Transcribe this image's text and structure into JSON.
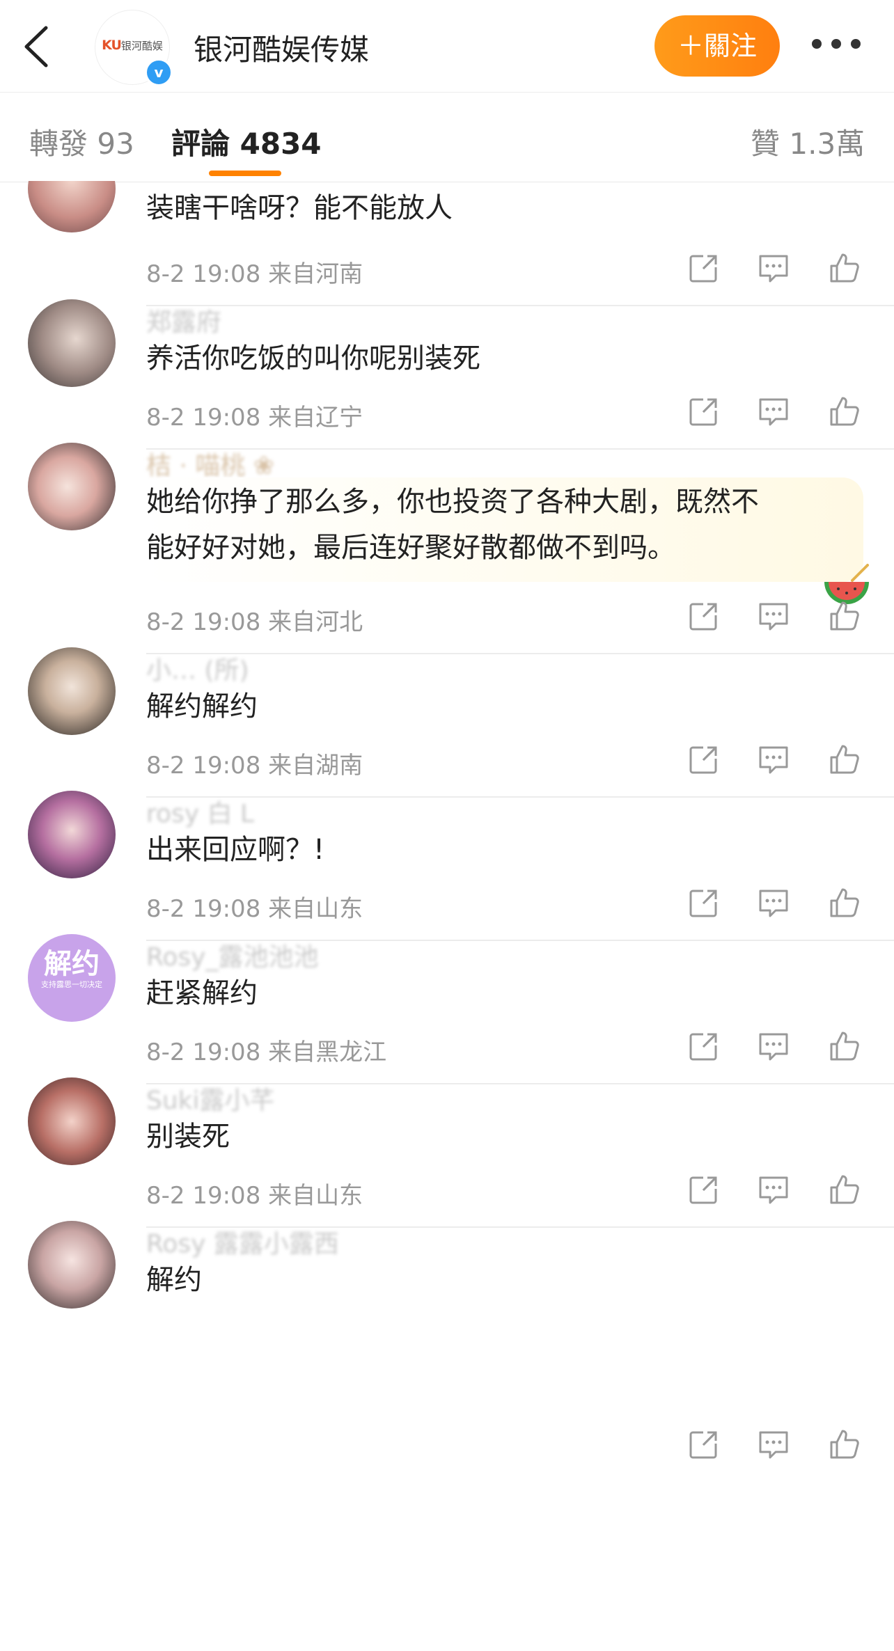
{
  "header": {
    "logo_ku": "KU",
    "logo_text": "银河酷娱",
    "verified_mark": "v",
    "account_name": "银河酷娱传媒",
    "follow_label": "＋關注",
    "back_icon": "chevron-left-icon",
    "more_icon": "more-dots-icon"
  },
  "tabs": [
    {
      "label": "轉發",
      "count": "93"
    },
    {
      "label": "評論",
      "count": "4834"
    },
    {
      "label": "贊",
      "count": "1.3萬"
    }
  ],
  "accent_color": "#ff8200",
  "comments": [
    {
      "user": "",
      "text": "装瞎干啥呀？能不能放人",
      "time": "8-2 19:08",
      "location": "来自河南"
    },
    {
      "user": "郑露府",
      "text": "养活你吃饭的叫你呢别装死",
      "time": "8-2 19:08",
      "location": "来自辽宁"
    },
    {
      "user": "桔 · 喵桃 ❀",
      "text_line1": "她给你挣了那么多，你也投资了各种大剧，既然不",
      "text_line2": "能好好对她，最后连好聚好散都做不到吗。",
      "time": "8-2 19:08",
      "location": "来自河北"
    },
    {
      "user": "小… (所)",
      "text": "解约解约",
      "time": "8-2 19:08",
      "location": "来自湖南"
    },
    {
      "user": "rosy 白 L",
      "text": "出来回应啊？!",
      "time": "8-2 19:08",
      "location": "来自山东"
    },
    {
      "user": "Rosy_露池池池",
      "text": "赶紧解约",
      "time": "8-2 19:08",
      "location": "来自黑龙江",
      "avatar_text": "解约",
      "avatar_small": "支持露思一切决定"
    },
    {
      "user": "Suki露小芊",
      "text": "别装死",
      "time": "8-2 19:08",
      "location": "来自山东"
    },
    {
      "user": "Rosy 露露小露西",
      "text": "解约",
      "time": "",
      "location": ""
    }
  ]
}
